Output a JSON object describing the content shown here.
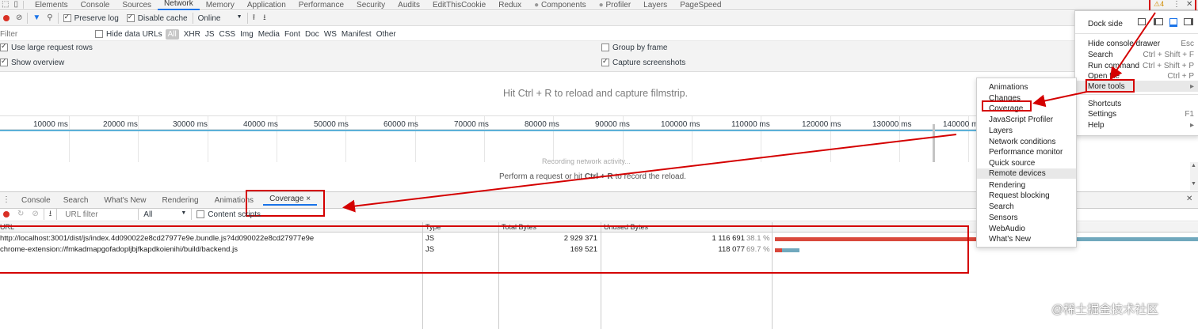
{
  "toolbar": {
    "tabs": [
      "Elements",
      "Console",
      "Sources",
      "Network",
      "Memory",
      "Application",
      "Performance",
      "Security",
      "Audits",
      "EditThisCookie",
      "Redux",
      "Components",
      "Profiler",
      "Layers",
      "PageSpeed"
    ],
    "active_tab": "Network",
    "warning_count": "4",
    "kebab_icon": "⋮",
    "close_icon": "✕"
  },
  "network": {
    "preserve_log": "Preserve log",
    "disable_cache": "Disable cache",
    "throttle_value": "Online",
    "filter_placeholder": "Filter",
    "hide_data_urls": "Hide data URLs",
    "types": [
      "All",
      "XHR",
      "JS",
      "CSS",
      "Img",
      "Media",
      "Font",
      "Doc",
      "WS",
      "Manifest",
      "Other"
    ],
    "use_large_rows": "Use large request rows",
    "show_overview": "Show overview",
    "group_by_frame": "Group by frame",
    "capture_screenshots": "Capture screenshots",
    "filmstrip_hint": "Hit Ctrl + R to reload and capture filmstrip.",
    "ticks": [
      "10000 ms",
      "20000 ms",
      "30000 ms",
      "40000 ms",
      "50000 ms",
      "60000 ms",
      "70000 ms",
      "80000 ms",
      "90000 ms",
      "100000 ms",
      "110000 ms",
      "120000 ms",
      "130000 ms",
      "140000 ms"
    ],
    "recording": "Recording network activity...",
    "perform_prefix": "Perform a request or hit ",
    "perform_key": "Ctrl + R",
    "perform_suffix": " to record the reload."
  },
  "drawer": {
    "tabs": [
      "Console",
      "Search",
      "What's New",
      "Rendering",
      "Animations"
    ],
    "coverage_tab": "Coverage",
    "coverage_close": "×",
    "url_filter_placeholder": "URL filter",
    "type_select": "All",
    "content_scripts": "Content scripts",
    "columns": [
      "URL",
      "Type",
      "Total Bytes",
      "Unused Bytes"
    ],
    "rows": [
      {
        "url": "http://localhost:3001/dist/js/index.4d090022e8cd27977e9e.bundle.js?4d090022e8cd27977e9e",
        "type": "JS",
        "total": "2 929 371",
        "unused": "1 116 691",
        "pct": "38.1 %",
        "used_fraction": 0.619
      },
      {
        "url": "chrome-extension://fmkadmapgofadopljbjfkapdkoienihi/build/backend.js",
        "type": "JS",
        "total": "169 521",
        "unused": "118 077",
        "pct": "69.7 %",
        "used_fraction": 0.303
      }
    ],
    "bar_colors": {
      "used": "#d9483b",
      "unused": "#70a8bd"
    }
  },
  "main_menu": {
    "dock_side": "Dock side",
    "items": [
      {
        "label": "Hide console drawer",
        "key": "Esc"
      },
      {
        "label": "Search",
        "key": "Ctrl + Shift + F"
      },
      {
        "label": "Run command",
        "key": "Ctrl + Shift + P"
      },
      {
        "label": "Open file",
        "key": "Ctrl + P"
      },
      {
        "label": "More tools",
        "key": "▸"
      },
      {
        "label": "Shortcuts",
        "key": ""
      },
      {
        "label": "Settings",
        "key": "F1"
      },
      {
        "label": "Help",
        "key": "▸"
      }
    ]
  },
  "more_tools_menu": {
    "items": [
      "Animations",
      "Changes",
      "Coverage",
      "JavaScript Profiler",
      "Layers",
      "Network conditions",
      "Performance monitor",
      "Quick source",
      "Remote devices",
      "Rendering",
      "Request blocking",
      "Search",
      "Sensors",
      "WebAudio",
      "What's New"
    ]
  },
  "watermark": "@稀土掘金技术社区"
}
